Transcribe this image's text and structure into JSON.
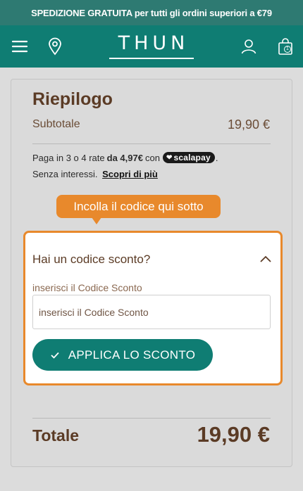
{
  "promo_bar": {
    "text": "SPEDIZIONE GRATUITA per tutti gli ordini superiori a €79"
  },
  "header": {
    "logo": "THUN",
    "icons": [
      "menu-icon",
      "location-pin-icon",
      "user-icon",
      "shopping-bag-icon"
    ],
    "cart_count": "1"
  },
  "summary": {
    "title": "Riepilogo",
    "subtotal_label": "Subtotale",
    "subtotal_value": "19,90 €",
    "installments": {
      "prefix": "Paga in 3 o 4 rate",
      "amount": "da 4,97€",
      "with": "con",
      "provider": "scalapay",
      "suffix": ".",
      "interest_text": "Senza interessi.",
      "link_text": "Scopri di più"
    },
    "total_label": "Totale",
    "total_value": "19,90 €"
  },
  "tooltip": {
    "text": "Incolla il codice qui sotto"
  },
  "coupon": {
    "title": "Hai un codice sconto?",
    "field_label": "inserisci il Codice Sconto",
    "input_placeholder": "inserisci il Codice Sconto",
    "input_value": "",
    "apply_label": "APPLICA LO SCONTO"
  },
  "colors": {
    "brand_teal": "#0f7d73",
    "promo_teal": "#2e7a72",
    "highlight_orange": "#e8892c",
    "text_brown": "#5b3b25"
  }
}
